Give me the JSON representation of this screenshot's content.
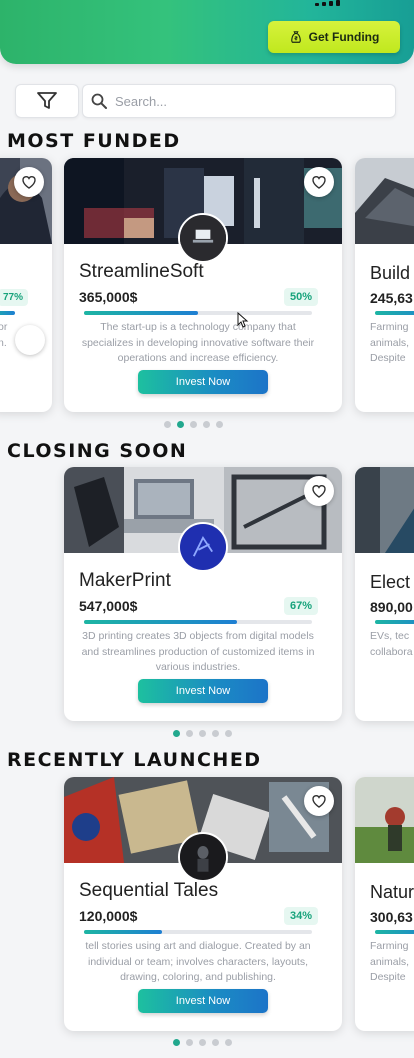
{
  "header": {
    "fund_button": "Get Funding"
  },
  "search": {
    "placeholder": "Search..."
  },
  "sections": {
    "most_funded": {
      "title": "MOST FUNDED",
      "left_card": {
        "pct": "77%",
        "desc_lines": [
          "or",
          "n."
        ]
      },
      "main": {
        "name": "StreamlineSoft",
        "amount": "365,000$",
        "pct": "50%",
        "progress": 0.5,
        "description": "The start-up is a technology company that specializes in developing innovative software their operations and increase efficiency.",
        "button": "Invest Now"
      },
      "right_card": {
        "name": "Build",
        "amount": "245,63",
        "desc_lines": [
          "Farming",
          "animals,",
          "Despite"
        ]
      },
      "dots": {
        "count": 5,
        "active": 1
      }
    },
    "closing_soon": {
      "title": "CLOSING SOON",
      "main": {
        "name": "MakerPrint",
        "amount": "547,000$",
        "pct": "67%",
        "progress": 0.67,
        "description": "3D printing creates 3D objects from digital models and streamlines production of customized items in various industries.",
        "button": "Invest Now"
      },
      "right_card": {
        "name": "Elect",
        "amount": "890,00",
        "desc_lines": [
          "EVs, tec",
          "collabora"
        ]
      },
      "dots": {
        "count": 5,
        "active": 0
      }
    },
    "recently_launched": {
      "title": "RECENTLY LAUNCHED",
      "main": {
        "name": "Sequential Tales",
        "amount": "120,000$",
        "pct": "34%",
        "progress": 0.34,
        "description": "tell stories using art and dialogue. Created by an individual or team; involves characters, layouts, drawing, coloring, and publishing.",
        "button": "Invest Now"
      },
      "right_card": {
        "name": "Natur",
        "amount": "300,63",
        "desc_lines": [
          "Farming",
          "animals,",
          "Despite"
        ]
      },
      "dots": {
        "count": 5,
        "active": 0
      }
    }
  },
  "colors": {
    "header_green": "#2db36a",
    "accent_teal": "#22a88e",
    "fund_button_lime": "#c9ed2a",
    "invest_button": "#1b8bc4"
  },
  "icons": [
    "money-bag-icon",
    "filter-icon",
    "search-icon",
    "heart-icon",
    "cursor-icon"
  ]
}
